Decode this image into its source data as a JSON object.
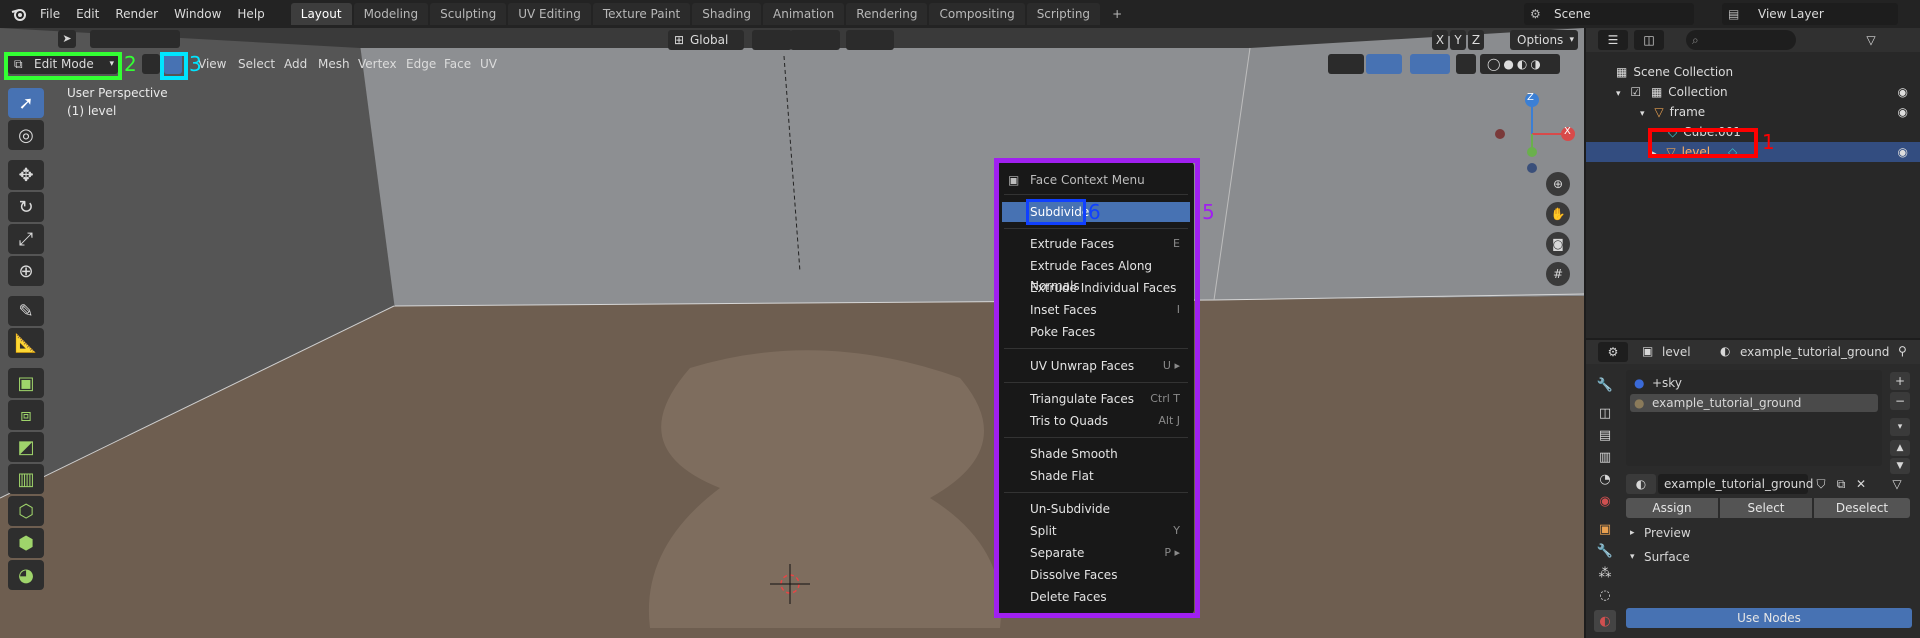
{
  "topbar": {
    "menus": [
      "File",
      "Edit",
      "Render",
      "Window",
      "Help"
    ],
    "workspace_tabs": [
      "Layout",
      "Modeling",
      "Sculpting",
      "UV Editing",
      "Texture Paint",
      "Shading",
      "Animation",
      "Rendering",
      "Compositing",
      "Scripting"
    ],
    "active_tab": "Layout",
    "add_tab": "+",
    "scene_label": "Scene",
    "view_layer_label": "View Layer"
  },
  "viewport_header": {
    "mode": "Edit Mode",
    "menus": [
      "View",
      "Select",
      "Add",
      "Mesh",
      "Vertex",
      "Edge",
      "Face",
      "UV"
    ],
    "transform_orientation": "Global",
    "axes": [
      "X",
      "Y",
      "Z"
    ],
    "options_label": "Options"
  },
  "viewport_overlay": {
    "perspective": "User Perspective",
    "object_info": "(1) level",
    "gizmo_axes": [
      "Z",
      "X"
    ]
  },
  "context_menu": {
    "title": "Face Context Menu",
    "items": [
      {
        "label": "Subdivide",
        "shortcut": ""
      },
      {
        "label": "Extrude Faces",
        "shortcut": "E"
      },
      {
        "label": "Extrude Faces Along Normals",
        "shortcut": ""
      },
      {
        "label": "Extrude Individual Faces",
        "shortcut": ""
      },
      {
        "label": "Inset Faces",
        "shortcut": "I"
      },
      {
        "label": "Poke Faces",
        "shortcut": ""
      },
      {
        "label": "UV Unwrap Faces",
        "shortcut": "U ▸"
      },
      {
        "label": "Triangulate Faces",
        "shortcut": "Ctrl T"
      },
      {
        "label": "Tris to Quads",
        "shortcut": "Alt J"
      },
      {
        "label": "Shade Smooth",
        "shortcut": ""
      },
      {
        "label": "Shade Flat",
        "shortcut": ""
      },
      {
        "label": "Un-Subdivide",
        "shortcut": ""
      },
      {
        "label": "Split",
        "shortcut": "Y"
      },
      {
        "label": "Separate",
        "shortcut": "P ▸"
      },
      {
        "label": "Dissolve Faces",
        "shortcut": ""
      },
      {
        "label": "Delete Faces",
        "shortcut": ""
      }
    ]
  },
  "outliner": {
    "search_placeholder": "",
    "rows": [
      {
        "label": "Scene Collection"
      },
      {
        "label": "Collection"
      },
      {
        "label": "frame"
      },
      {
        "label": "Cube.001"
      },
      {
        "label": "level"
      }
    ]
  },
  "properties": {
    "object_name": "level",
    "material_name": "example_tutorial_ground",
    "material_slots": [
      "+sky",
      "example_tutorial_ground"
    ],
    "material_field": "example_tutorial_ground",
    "buttons": [
      "Assign",
      "Select",
      "Deselect"
    ],
    "panels": [
      "Preview",
      "Surface"
    ],
    "use_nodes_label": "Use Nodes"
  },
  "annotations": [
    "1",
    "2",
    "3",
    "5",
    "6"
  ],
  "colors": {
    "selection_blue": "#4772b3",
    "menu_bg": "#181818",
    "annotation_red": "#ff0000",
    "annotation_green": "#33ff33",
    "annotation_cyan": "#00e5ff",
    "annotation_purple": "#a020f0",
    "annotation_blue": "#1040ff"
  }
}
